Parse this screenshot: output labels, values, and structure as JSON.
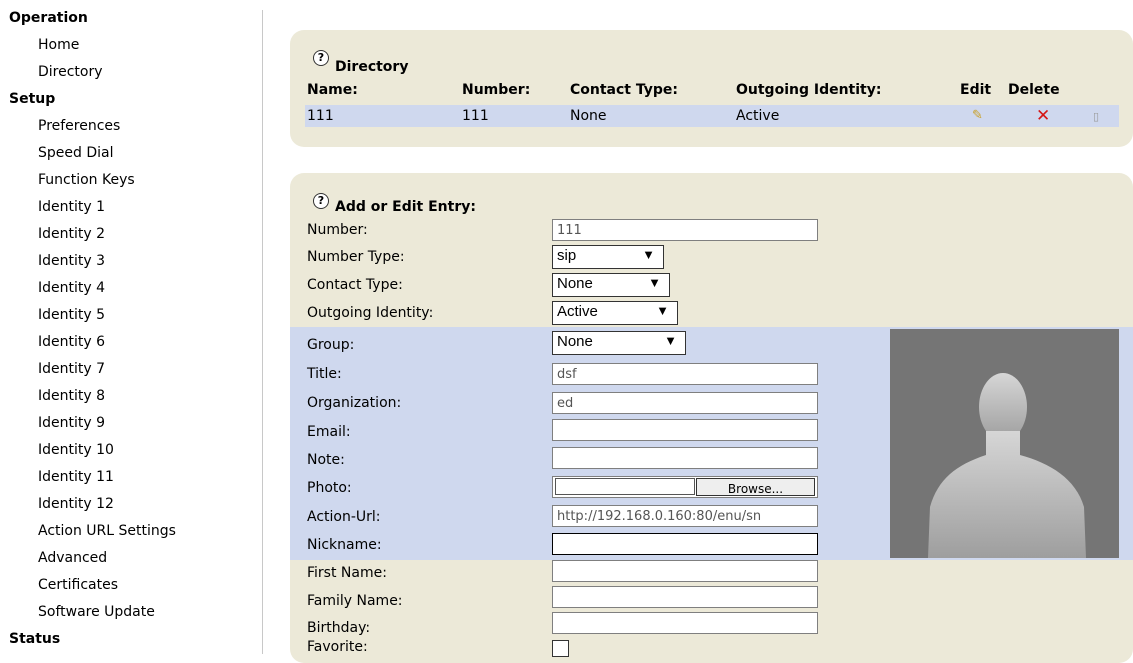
{
  "sidebar": {
    "operation": {
      "title": "Operation",
      "items": [
        "Home",
        "Directory"
      ]
    },
    "setup": {
      "title": "Setup",
      "items": [
        "Preferences",
        "Speed Dial",
        "Function Keys",
        "Identity 1",
        "Identity 2",
        "Identity 3",
        "Identity 4",
        "Identity 5",
        "Identity 6",
        "Identity 7",
        "Identity 8",
        "Identity 9",
        "Identity 10",
        "Identity 11",
        "Identity 12",
        "Action URL Settings",
        "Advanced",
        "Certificates",
        "Software Update"
      ]
    },
    "status": {
      "title": "Status"
    }
  },
  "directory": {
    "title": "Directory",
    "headers": {
      "name": "Name:",
      "number": "Number:",
      "contact_type": "Contact Type:",
      "outgoing_identity": "Outgoing Identity:",
      "edit": "Edit",
      "delete": "Delete"
    },
    "rows": [
      {
        "name": "111",
        "number": "111",
        "contact_type": "None",
        "outgoing_identity": "Active"
      }
    ]
  },
  "edit_entry": {
    "title": "Add or Edit Entry:",
    "labels": {
      "number": "Number:",
      "number_type": "Number Type:",
      "contact_type": "Contact Type:",
      "outgoing_identity": "Outgoing Identity:",
      "group": "Group:",
      "title": "Title:",
      "organization": "Organization:",
      "email": "Email:",
      "note": "Note:",
      "photo": "Photo:",
      "action_url": "Action-Url:",
      "nickname": "Nickname:",
      "first_name": "First Name:",
      "family_name": "Family Name:",
      "birthday": "Birthday:",
      "favorite": "Favorite:"
    },
    "values": {
      "number": "111",
      "number_type": "sip",
      "contact_type": "None",
      "outgoing_identity": "Active",
      "group": "None",
      "title": "dsf",
      "organization": "ed",
      "email": "",
      "note": "",
      "action_url": "http://192.168.0.160:80/enu/sn",
      "nickname": "",
      "first_name": "",
      "family_name": "",
      "birthday": ""
    },
    "browse_label": "Browse..."
  },
  "icons": {
    "help": "?",
    "edit": "✎",
    "delete": "✕",
    "more": "▯"
  }
}
